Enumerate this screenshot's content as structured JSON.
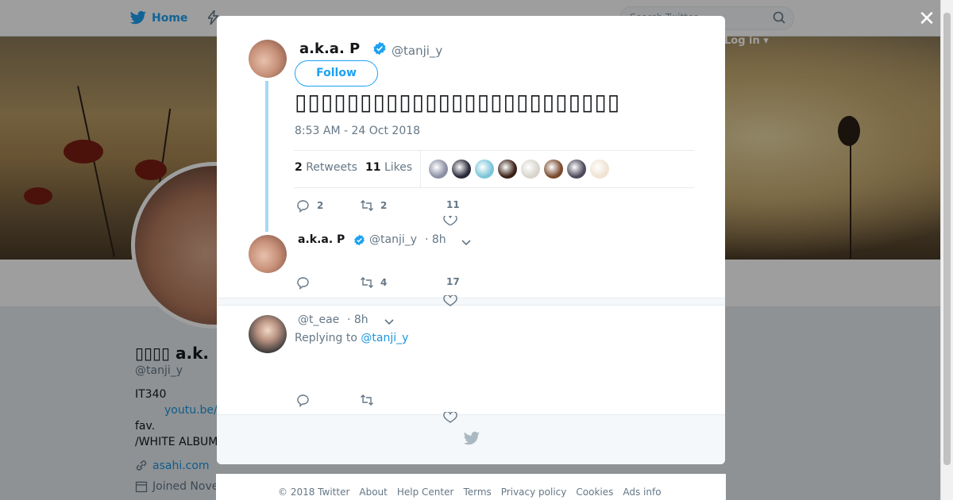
{
  "topbar": {
    "home_label": "Home",
    "moments_label": "M",
    "search_placeholder": "Search Twitter",
    "login_label": "Log in"
  },
  "profile": {
    "name": "▯▯▯▯ a.k.",
    "handle": "@tanji_y",
    "bio_line1": "IT340",
    "bio_link": "youtu.be/",
    "bio_line2": "fav.",
    "bio_line3": "/WHITE ALBUM",
    "website": "asahi.com",
    "joined": "Joined Nove"
  },
  "modal": {
    "tweet": {
      "author_name": "a.k.a. P",
      "author_handle": "@tanji_y",
      "follow_label": "Follow",
      "text": "▯▯▯▯▯▯▯▯▯▯▯▯▯▯▯▯▯▯▯▯▯▯▯▯▯",
      "timestamp": "8:53 AM - 24 Oct 2018",
      "retweets_count": "2",
      "retweets_label": "Retweets",
      "likes_count": "11",
      "likes_label": "Likes",
      "likers": [
        "#8a8fa3",
        "#2a2a3a",
        "#7bc5d9",
        "#3b2016",
        "#d8d4cc",
        "#7a4a2e",
        "#4e4a5c",
        "#f0e3d2"
      ],
      "actions": {
        "replies": "2",
        "retweets": "2",
        "likes": "11"
      }
    },
    "reply1": {
      "author_name": "a.k.a. P",
      "author_handle": "@tanji_y",
      "time": "· 8h",
      "actions": {
        "replies": "",
        "retweets": "4",
        "likes": "17"
      }
    },
    "reply2": {
      "author_handle": "@t_eae",
      "time": "· 8h",
      "replying_prefix": "Replying to",
      "replying_to": "@tanji_y"
    }
  },
  "footer": {
    "copyright": "© 2018 Twitter",
    "links": [
      "About",
      "Help Center",
      "Terms",
      "Privacy policy",
      "Cookies",
      "Ads info"
    ]
  },
  "colors": {
    "accent": "#1da1f2",
    "link": "#1b95e0",
    "thread_line": "#a5d9f3"
  }
}
